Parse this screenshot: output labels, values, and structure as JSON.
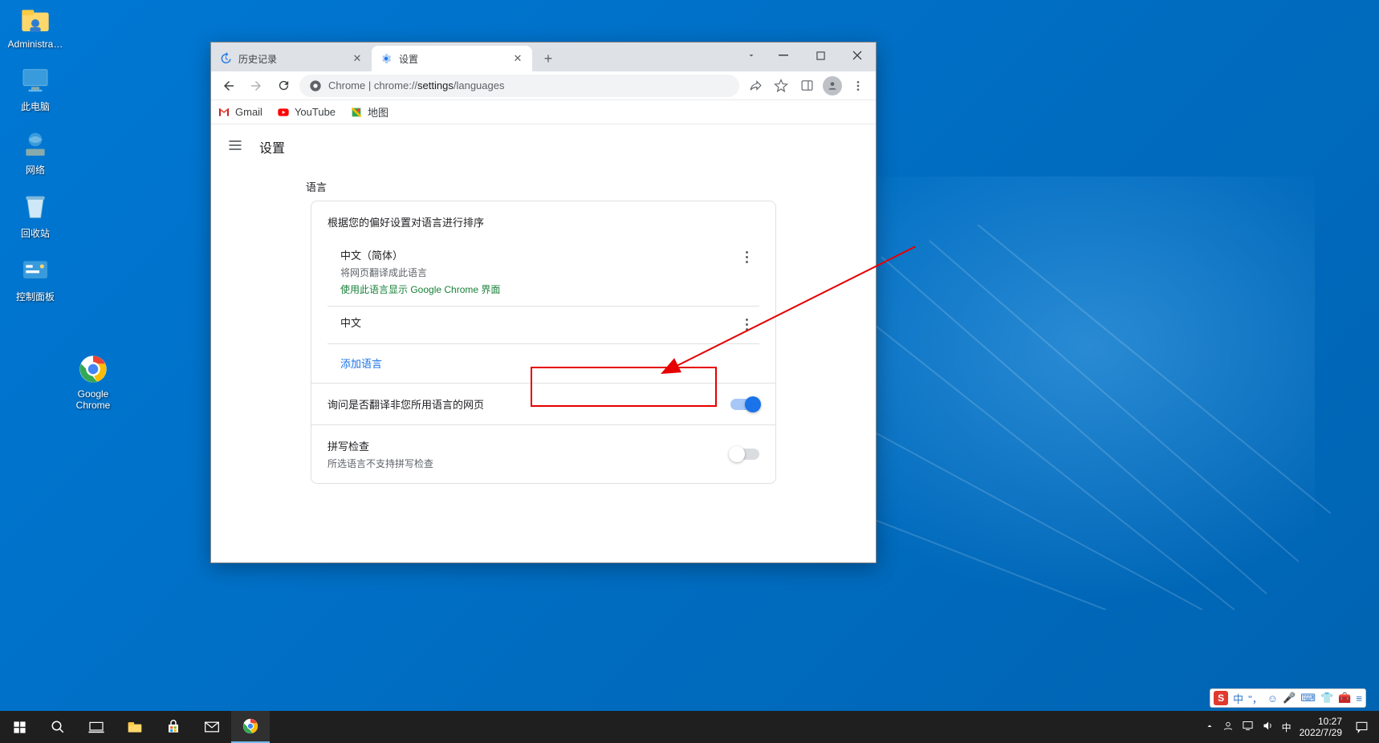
{
  "desktop": {
    "icons": [
      {
        "label": "Administra…"
      },
      {
        "label": "此电脑"
      },
      {
        "label": "网络"
      },
      {
        "label": "回收站"
      },
      {
        "label": "控制面板"
      }
    ],
    "chrome_shortcut_label": "Google Chrome"
  },
  "chrome": {
    "tabs": [
      {
        "title": "历史记录"
      },
      {
        "title": "设置"
      }
    ],
    "address_prefix": "Chrome",
    "address_sep": " | ",
    "address_host": "chrome://",
    "address_path_strong": "settings",
    "address_path_tail": "/languages",
    "bookmarks": [
      {
        "label": "Gmail"
      },
      {
        "label": "YouTube"
      },
      {
        "label": "地图"
      }
    ],
    "settings_title": "设置",
    "section_label": "语言",
    "card_head": "根据您的偏好设置对语言进行排序",
    "languages": [
      {
        "title": "中文（简体）",
        "sub1": "将网页翻译成此语言",
        "sub2": "使用此语言显示 Google Chrome 界面"
      },
      {
        "title": "中文"
      }
    ],
    "add_language": "添加语言",
    "translate_prompt": "询问是否翻译非您所用语言的网页",
    "spellcheck_title": "拼写检查",
    "spellcheck_sub": "所选语言不支持拼写检查"
  },
  "ime": {
    "badge": "S",
    "mode": "中"
  },
  "taskbar": {
    "lang": "中",
    "time": "10:27",
    "date": "2022/7/29"
  }
}
